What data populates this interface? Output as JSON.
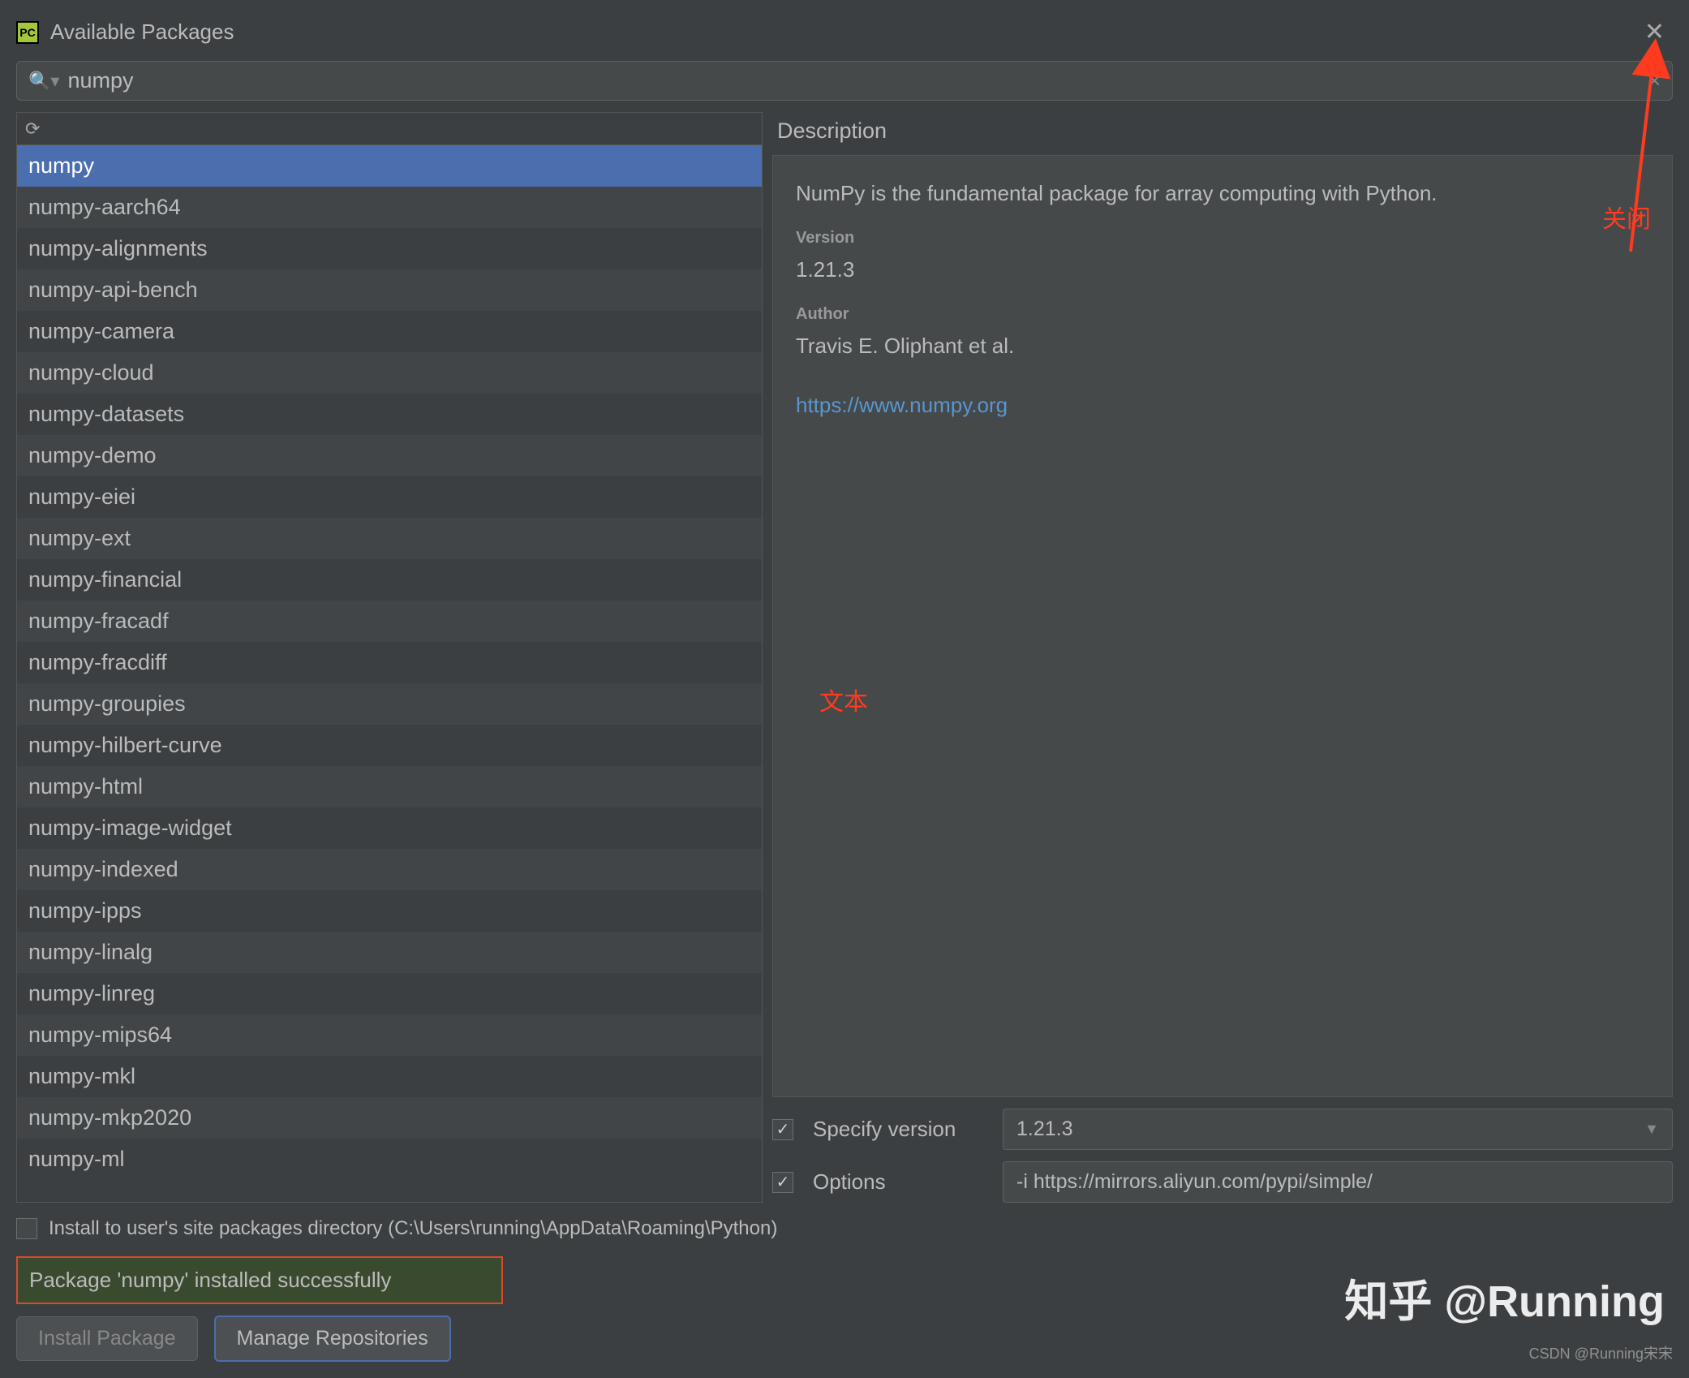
{
  "window": {
    "title": "Available Packages"
  },
  "search": {
    "value": "numpy"
  },
  "packages": [
    "numpy",
    "numpy-aarch64",
    "numpy-alignments",
    "numpy-api-bench",
    "numpy-camera",
    "numpy-cloud",
    "numpy-datasets",
    "numpy-demo",
    "numpy-eiei",
    "numpy-ext",
    "numpy-financial",
    "numpy-fracadf",
    "numpy-fracdiff",
    "numpy-groupies",
    "numpy-hilbert-curve",
    "numpy-html",
    "numpy-image-widget",
    "numpy-indexed",
    "numpy-ipps",
    "numpy-linalg",
    "numpy-linreg",
    "numpy-mips64",
    "numpy-mkl",
    "numpy-mkp2020",
    "numpy-ml"
  ],
  "selected_index": 0,
  "description": {
    "header": "Description",
    "summary": "NumPy is the fundamental package for array computing with Python.",
    "version_label": "Version",
    "version": "1.21.3",
    "author_label": "Author",
    "author": "Travis E. Oliphant et al.",
    "link": "https://www.numpy.org"
  },
  "options": {
    "specify_version_label": "Specify version",
    "specify_version_checked": true,
    "specify_version_value": "1.21.3",
    "options_label": "Options",
    "options_checked": true,
    "options_value": "-i  https://mirrors.aliyun.com/pypi/simple/"
  },
  "install_to_user": {
    "checked": false,
    "label": "Install to user's site packages directory (C:\\Users\\running\\AppData\\Roaming\\Python)"
  },
  "status": "Package 'numpy' installed successfully",
  "buttons": {
    "install": "Install Package",
    "manage": "Manage Repositories"
  },
  "annotations": {
    "close": "关闭",
    "text": "文本"
  },
  "watermark1": "知乎 @Running",
  "watermark2": "CSDN @Running宋宋"
}
